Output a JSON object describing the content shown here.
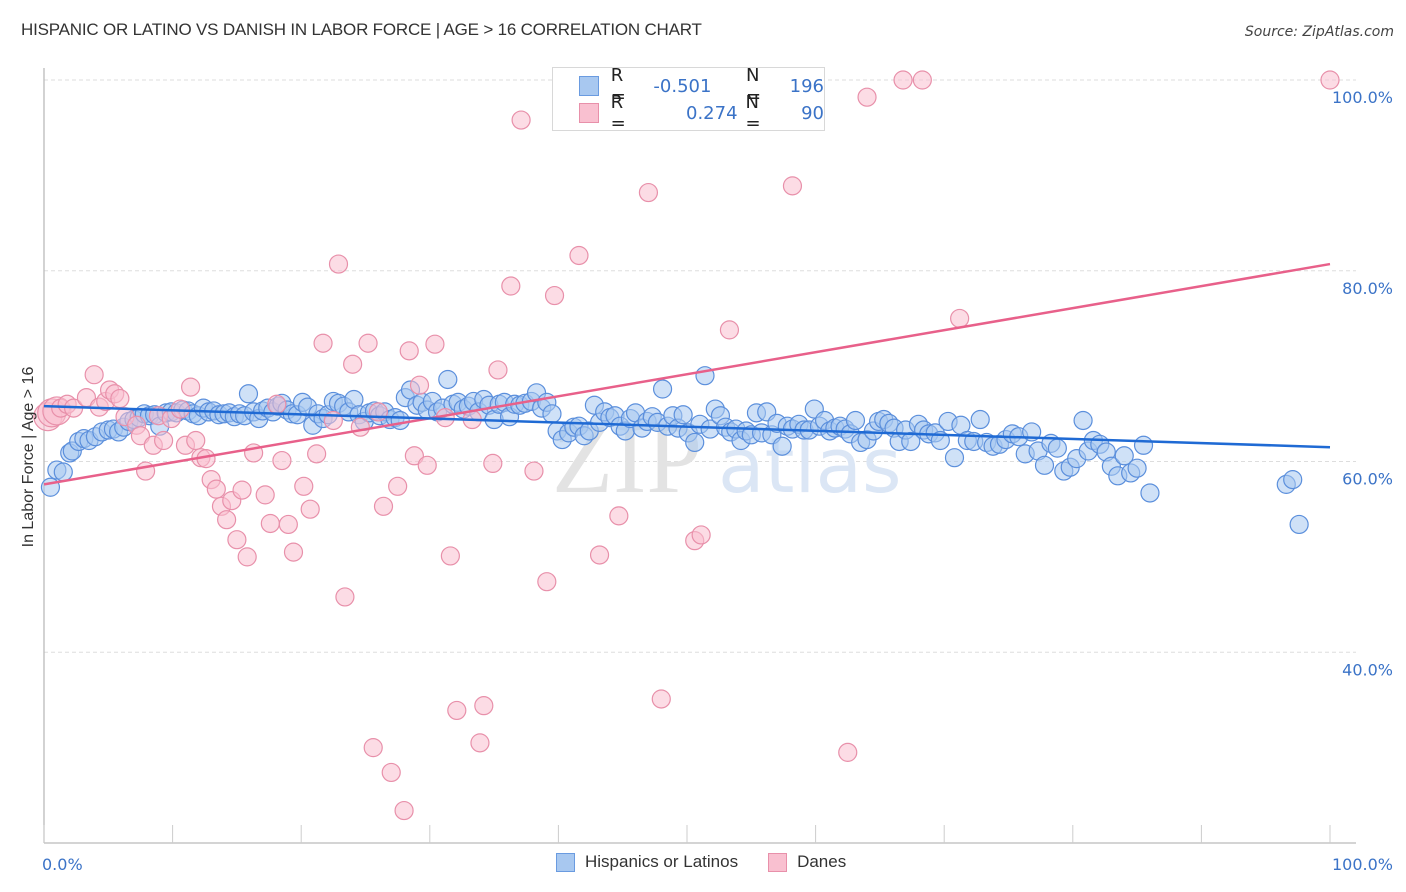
{
  "header": {
    "title": "HISPANIC OR LATINO VS DANISH IN LABOR FORCE | AGE > 16 CORRELATION CHART",
    "source": "Source: ZipAtlas.com"
  },
  "legend_stats": [
    {
      "series": "Hispanics or Latinos",
      "r_label": "R =",
      "r_value": "-0.501",
      "n_label": "N =",
      "n_value": "196",
      "color": "#a8c8f0",
      "border": "#6a9be0"
    },
    {
      "series": "Danes",
      "r_label": "R =",
      "r_value": "0.274",
      "n_label": "N =",
      "n_value": "90",
      "color": "#f9c0d0",
      "border": "#e890aa"
    }
  ],
  "watermark": {
    "part1": "ZIP",
    "part2": "atlas"
  },
  "colors": {
    "blue_fill": "#a8c8f0",
    "blue_stroke": "#5b8fdc",
    "blue_line": "#1f6ad4",
    "pink_fill": "#f9c0d0",
    "pink_stroke": "#e890aa",
    "pink_line": "#e8608a",
    "tick_text": "#3b73c7",
    "grid": "#dddddd"
  },
  "chart_data": {
    "type": "scatter",
    "title": "HISPANIC OR LATINO VS DANISH IN LABOR FORCE | AGE > 16 CORRELATION CHART",
    "xlabel": "",
    "ylabel": "In Labor Force | Age > 16",
    "xlim": [
      0,
      100
    ],
    "ylim": [
      20,
      100
    ],
    "x_tick_labels": [
      "0.0%",
      "100.0%"
    ],
    "y_ticks": [
      40,
      60,
      80,
      100
    ],
    "y_tick_labels": [
      "40.0%",
      "60.0%",
      "80.0%",
      "100.0%"
    ],
    "grid": true,
    "legend_position": "bottom-center",
    "series": [
      {
        "name": "Hispanics or Latinos",
        "r": -0.501,
        "n": 196,
        "trend": {
          "x": [
            0,
            100
          ],
          "y": [
            65.8,
            61.5
          ]
        },
        "points": [
          [
            0.5,
            57.3
          ],
          [
            1.0,
            59.1
          ],
          [
            1.5,
            58.9
          ],
          [
            2.0,
            60.9
          ],
          [
            2.2,
            61.1
          ],
          [
            2.7,
            62.1
          ],
          [
            3.1,
            62.4
          ],
          [
            3.5,
            62.2
          ],
          [
            4.0,
            62.6
          ],
          [
            4.5,
            63.1
          ],
          [
            5.0,
            63.3
          ],
          [
            5.4,
            63.4
          ],
          [
            5.8,
            63.1
          ],
          [
            6.2,
            63.6
          ],
          [
            6.6,
            64.2
          ],
          [
            7.0,
            64.4
          ],
          [
            7.4,
            64.6
          ],
          [
            7.8,
            65.0
          ],
          [
            8.2,
            64.8
          ],
          [
            8.6,
            64.9
          ],
          [
            9.0,
            63.7
          ],
          [
            9.5,
            65.1
          ],
          [
            9.9,
            65.2
          ],
          [
            10.3,
            65.1
          ],
          [
            10.8,
            65.4
          ],
          [
            11.2,
            65.3
          ],
          [
            11.6,
            65.0
          ],
          [
            12.0,
            64.8
          ],
          [
            12.4,
            65.6
          ],
          [
            12.8,
            65.2
          ],
          [
            13.2,
            65.3
          ],
          [
            13.6,
            64.9
          ],
          [
            14.0,
            65.0
          ],
          [
            14.4,
            65.1
          ],
          [
            14.8,
            64.7
          ],
          [
            15.2,
            65.0
          ],
          [
            15.6,
            64.8
          ],
          [
            15.9,
            67.1
          ],
          [
            16.3,
            65.2
          ],
          [
            16.7,
            64.5
          ],
          [
            17.0,
            65.3
          ],
          [
            17.4,
            65.6
          ],
          [
            17.8,
            65.2
          ],
          [
            18.2,
            65.8
          ],
          [
            18.5,
            66.1
          ],
          [
            18.9,
            65.4
          ],
          [
            19.3,
            65.0
          ],
          [
            19.7,
            64.9
          ],
          [
            20.1,
            66.2
          ],
          [
            20.5,
            65.7
          ],
          [
            20.9,
            63.8
          ],
          [
            21.3,
            65.0
          ],
          [
            21.7,
            64.5
          ],
          [
            22.1,
            64.9
          ],
          [
            22.5,
            66.3
          ],
          [
            22.9,
            66.1
          ],
          [
            23.3,
            65.8
          ],
          [
            23.7,
            65.2
          ],
          [
            24.1,
            66.5
          ],
          [
            24.5,
            64.9
          ],
          [
            24.9,
            64.2
          ],
          [
            25.3,
            65.1
          ],
          [
            25.7,
            65.3
          ],
          [
            26.1,
            64.8
          ],
          [
            26.5,
            65.2
          ],
          [
            26.9,
            64.4
          ],
          [
            27.3,
            64.6
          ],
          [
            27.7,
            64.3
          ],
          [
            28.1,
            66.7
          ],
          [
            28.5,
            67.5
          ],
          [
            29.0,
            65.9
          ],
          [
            29.4,
            66.2
          ],
          [
            29.8,
            65.4
          ],
          [
            30.2,
            66.3
          ],
          [
            30.6,
            65.2
          ],
          [
            31.0,
            65.6
          ],
          [
            31.4,
            68.6
          ],
          [
            31.8,
            66.0
          ],
          [
            32.2,
            66.2
          ],
          [
            32.6,
            65.5
          ],
          [
            33.0,
            65.8
          ],
          [
            33.4,
            66.3
          ],
          [
            33.8,
            65.2
          ],
          [
            34.2,
            66.5
          ],
          [
            34.6,
            65.9
          ],
          [
            35.0,
            64.4
          ],
          [
            35.4,
            66.0
          ],
          [
            35.8,
            66.2
          ],
          [
            36.2,
            64.7
          ],
          [
            36.6,
            66.0
          ],
          [
            37.0,
            65.9
          ],
          [
            37.4,
            66.1
          ],
          [
            37.9,
            66.3
          ],
          [
            38.3,
            67.2
          ],
          [
            38.7,
            65.6
          ],
          [
            39.1,
            66.2
          ],
          [
            39.5,
            65.0
          ],
          [
            39.9,
            63.2
          ],
          [
            40.3,
            62.3
          ],
          [
            40.8,
            63.0
          ],
          [
            41.2,
            63.6
          ],
          [
            41.6,
            63.7
          ],
          [
            42.0,
            62.7
          ],
          [
            42.4,
            63.2
          ],
          [
            42.8,
            65.9
          ],
          [
            43.2,
            64.1
          ],
          [
            43.6,
            65.2
          ],
          [
            44.0,
            64.6
          ],
          [
            44.4,
            64.8
          ],
          [
            44.8,
            63.7
          ],
          [
            45.2,
            63.2
          ],
          [
            45.6,
            64.5
          ],
          [
            46.0,
            65.1
          ],
          [
            46.5,
            63.5
          ],
          [
            46.9,
            64.2
          ],
          [
            47.3,
            64.7
          ],
          [
            47.7,
            64.1
          ],
          [
            48.1,
            67.6
          ],
          [
            48.5,
            63.7
          ],
          [
            48.9,
            64.8
          ],
          [
            49.3,
            63.5
          ],
          [
            49.7,
            64.9
          ],
          [
            50.1,
            63.0
          ],
          [
            50.6,
            62.0
          ],
          [
            51.0,
            63.9
          ],
          [
            51.4,
            69.0
          ],
          [
            51.8,
            63.4
          ],
          [
            52.2,
            65.5
          ],
          [
            52.6,
            64.8
          ],
          [
            53.0,
            63.6
          ],
          [
            53.4,
            63.1
          ],
          [
            53.8,
            63.4
          ],
          [
            54.2,
            62.2
          ],
          [
            54.6,
            63.2
          ],
          [
            55.0,
            62.8
          ],
          [
            55.4,
            65.1
          ],
          [
            55.8,
            63.0
          ],
          [
            56.2,
            65.2
          ],
          [
            56.6,
            62.8
          ],
          [
            57.0,
            64.0
          ],
          [
            57.4,
            61.6
          ],
          [
            57.8,
            63.7
          ],
          [
            58.2,
            63.4
          ],
          [
            58.7,
            63.9
          ],
          [
            59.1,
            63.3
          ],
          [
            59.5,
            63.3
          ],
          [
            59.9,
            65.5
          ],
          [
            60.3,
            63.7
          ],
          [
            60.7,
            64.3
          ],
          [
            61.1,
            63.2
          ],
          [
            61.5,
            63.5
          ],
          [
            61.9,
            63.7
          ],
          [
            62.3,
            63.4
          ],
          [
            62.7,
            62.9
          ],
          [
            63.1,
            64.3
          ],
          [
            63.5,
            62.0
          ],
          [
            64.0,
            62.3
          ],
          [
            64.5,
            63.2
          ],
          [
            64.9,
            64.2
          ],
          [
            65.3,
            64.4
          ],
          [
            65.7,
            64.0
          ],
          [
            66.1,
            63.5
          ],
          [
            66.5,
            62.1
          ],
          [
            67.0,
            63.3
          ],
          [
            67.4,
            62.1
          ],
          [
            68.0,
            63.9
          ],
          [
            68.4,
            63.3
          ],
          [
            68.8,
            62.9
          ],
          [
            69.3,
            63.0
          ],
          [
            69.7,
            62.2
          ],
          [
            70.3,
            64.2
          ],
          [
            70.8,
            60.4
          ],
          [
            71.3,
            63.8
          ],
          [
            71.8,
            62.2
          ],
          [
            72.3,
            62.1
          ],
          [
            72.8,
            64.4
          ],
          [
            73.3,
            62.0
          ],
          [
            73.8,
            61.6
          ],
          [
            74.3,
            61.8
          ],
          [
            74.8,
            62.3
          ],
          [
            75.3,
            62.9
          ],
          [
            75.8,
            62.6
          ],
          [
            76.3,
            60.8
          ],
          [
            76.8,
            63.1
          ],
          [
            77.3,
            61.1
          ],
          [
            77.8,
            59.6
          ],
          [
            78.3,
            61.9
          ],
          [
            78.8,
            61.4
          ],
          [
            79.3,
            59.0
          ],
          [
            79.8,
            59.4
          ],
          [
            80.3,
            60.3
          ],
          [
            80.8,
            64.3
          ],
          [
            81.2,
            61.1
          ],
          [
            81.6,
            62.2
          ],
          [
            82.1,
            61.8
          ],
          [
            82.6,
            61.0
          ],
          [
            83.0,
            59.5
          ],
          [
            83.5,
            58.5
          ],
          [
            84.0,
            60.6
          ],
          [
            84.5,
            58.8
          ],
          [
            85.0,
            59.3
          ],
          [
            85.5,
            61.7
          ],
          [
            86.0,
            56.7
          ],
          [
            96.6,
            57.6
          ],
          [
            97.1,
            58.1
          ],
          [
            97.6,
            53.4
          ]
        ]
      },
      {
        "name": "Danes",
        "r": 0.274,
        "n": 90,
        "trend": {
          "x": [
            0,
            100
          ],
          "y": [
            57.6,
            80.7
          ]
        },
        "points": [
          [
            0.3,
            64.7
          ],
          [
            0.6,
            65.1
          ],
          [
            1.0,
            65.3
          ],
          [
            1.3,
            65.6
          ],
          [
            1.8,
            66.0
          ],
          [
            2.3,
            65.6
          ],
          [
            3.3,
            66.7
          ],
          [
            3.9,
            69.1
          ],
          [
            4.3,
            65.7
          ],
          [
            4.8,
            66.3
          ],
          [
            5.1,
            67.5
          ],
          [
            5.5,
            67.1
          ],
          [
            5.9,
            66.6
          ],
          [
            6.3,
            64.7
          ],
          [
            7.2,
            63.8
          ],
          [
            7.5,
            62.7
          ],
          [
            7.9,
            59.0
          ],
          [
            8.5,
            61.7
          ],
          [
            8.9,
            64.8
          ],
          [
            9.3,
            62.2
          ],
          [
            9.9,
            64.5
          ],
          [
            10.6,
            65.5
          ],
          [
            11.0,
            61.7
          ],
          [
            11.4,
            67.8
          ],
          [
            11.8,
            62.2
          ],
          [
            12.2,
            60.4
          ],
          [
            12.6,
            60.3
          ],
          [
            13.0,
            58.1
          ],
          [
            13.4,
            57.1
          ],
          [
            13.8,
            55.3
          ],
          [
            14.2,
            53.9
          ],
          [
            14.6,
            55.9
          ],
          [
            15.0,
            51.8
          ],
          [
            15.4,
            57.0
          ],
          [
            15.8,
            50.0
          ],
          [
            16.3,
            60.9
          ],
          [
            17.2,
            56.5
          ],
          [
            17.6,
            53.5
          ],
          [
            18.1,
            66.0
          ],
          [
            18.5,
            60.1
          ],
          [
            19.0,
            53.4
          ],
          [
            19.4,
            50.5
          ],
          [
            20.2,
            57.4
          ],
          [
            20.7,
            55.0
          ],
          [
            21.2,
            60.8
          ],
          [
            21.7,
            72.4
          ],
          [
            22.5,
            64.3
          ],
          [
            22.9,
            80.7
          ],
          [
            23.4,
            45.8
          ],
          [
            24.0,
            70.2
          ],
          [
            24.6,
            63.6
          ],
          [
            25.2,
            72.4
          ],
          [
            25.6,
            30.0
          ],
          [
            26.0,
            65.2
          ],
          [
            26.4,
            55.3
          ],
          [
            27.0,
            27.4
          ],
          [
            27.5,
            57.4
          ],
          [
            28.0,
            23.4
          ],
          [
            28.4,
            71.6
          ],
          [
            28.8,
            60.6
          ],
          [
            29.2,
            68.0
          ],
          [
            29.8,
            59.6
          ],
          [
            30.4,
            72.3
          ],
          [
            31.2,
            64.6
          ],
          [
            31.6,
            50.1
          ],
          [
            32.1,
            33.9
          ],
          [
            33.3,
            64.4
          ],
          [
            33.9,
            30.5
          ],
          [
            34.2,
            34.4
          ],
          [
            34.9,
            59.8
          ],
          [
            35.3,
            69.6
          ],
          [
            36.3,
            78.4
          ],
          [
            37.1,
            95.8
          ],
          [
            38.1,
            59.0
          ],
          [
            39.1,
            47.4
          ],
          [
            39.7,
            77.4
          ],
          [
            41.6,
            81.6
          ],
          [
            43.2,
            50.2
          ],
          [
            44.7,
            54.3
          ],
          [
            47.0,
            88.2
          ],
          [
            48.0,
            35.1
          ],
          [
            50.6,
            51.7
          ],
          [
            51.1,
            52.3
          ],
          [
            53.3,
            73.8
          ],
          [
            58.2,
            88.9
          ],
          [
            62.5,
            29.5
          ],
          [
            64.0,
            98.2
          ],
          [
            66.8,
            100.0
          ],
          [
            68.3,
            100.0
          ],
          [
            71.2,
            75.0
          ],
          [
            100.0,
            100.0
          ]
        ]
      }
    ]
  }
}
